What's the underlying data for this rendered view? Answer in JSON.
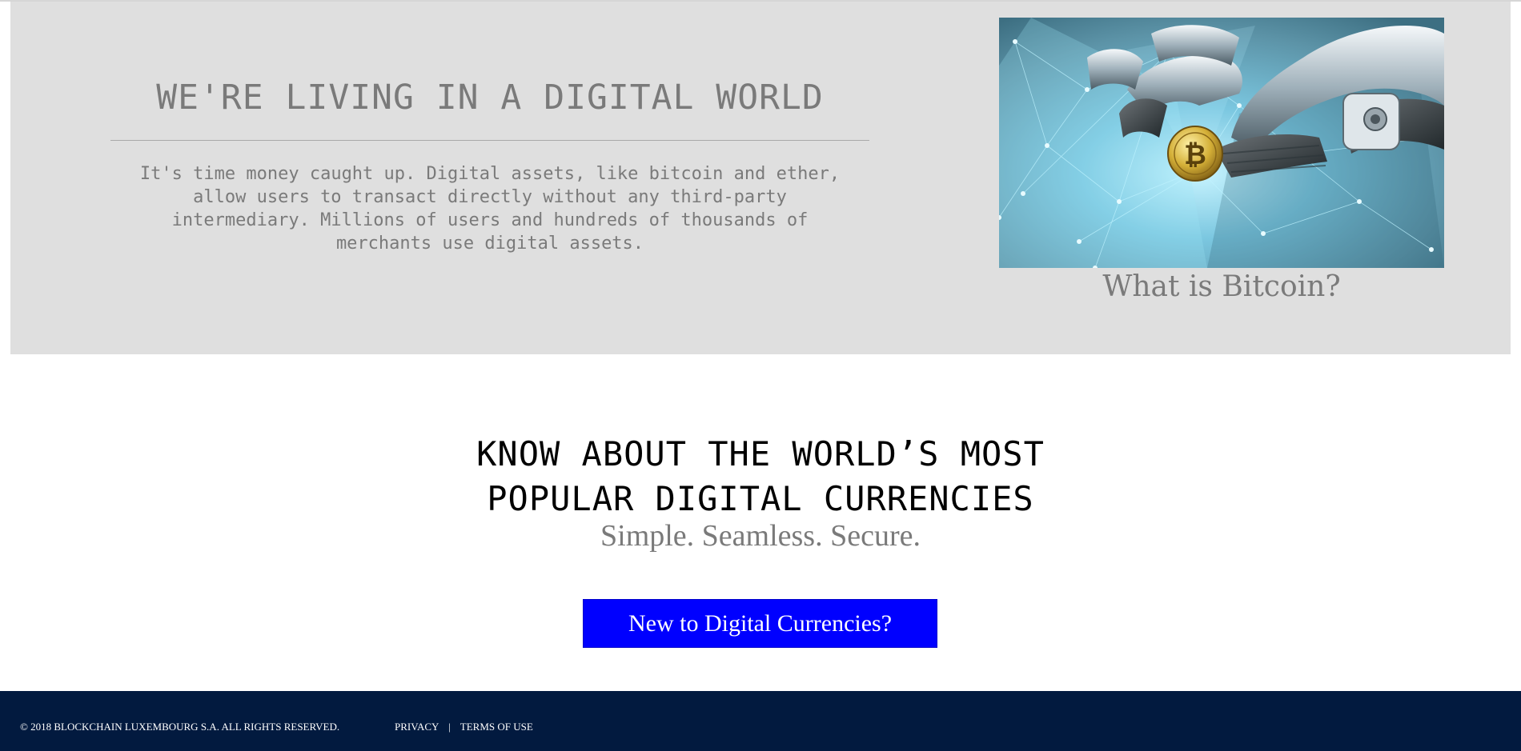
{
  "hero": {
    "title": "WE'RE LIVING IN A DIGITAL WORLD",
    "description": "It's time money caught up. Digital assets, like bitcoin and ether, allow users to transact directly without any third-party intermediary. Millions of users and hundreds of thousands of merchants use digital assets.",
    "image_icon": "bitcoin-robot-hand-image",
    "caption": "What is Bitcoin?"
  },
  "promo": {
    "heading_line1": "KNOW ABOUT THE WORLD’S MOST",
    "heading_line2": "POPULAR DIGITAL CURRENCIES",
    "subheading": "Simple. Seamless. Secure.",
    "cta_label": "New to Digital Currencies?"
  },
  "footer": {
    "copyright": "© 2018 BLOCKCHAIN LUXEMBOURG S.A. ALL RIGHTS RESERVED.",
    "links": [
      "PRIVACY",
      "TERMS OF USE"
    ],
    "separator": "|"
  },
  "colors": {
    "hero_background": "#dfdfdf",
    "muted_text": "#7a7a7a",
    "cta_background": "#0000ff",
    "footer_background": "#021a3f"
  }
}
